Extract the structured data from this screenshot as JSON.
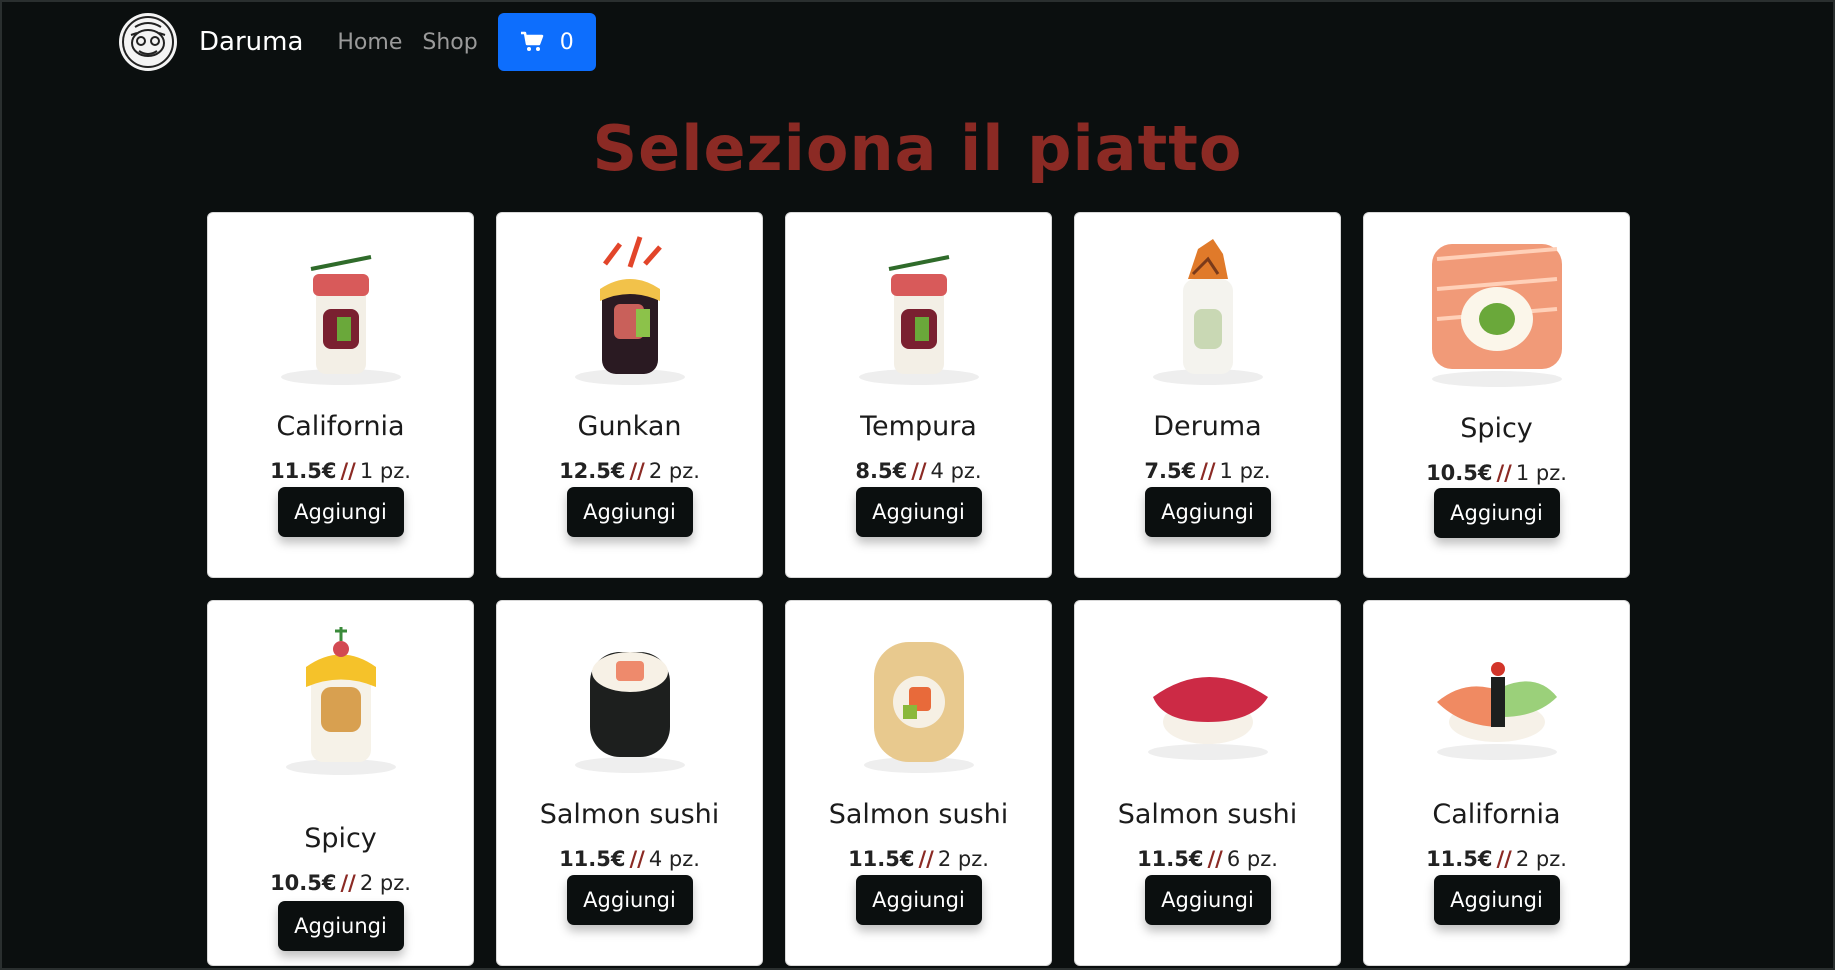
{
  "navbar": {
    "brand": "Daruma",
    "links": [
      "Home",
      "Shop"
    ],
    "cart_count": "0"
  },
  "page_title": "Seleziona il piatto",
  "products": [
    {
      "name": "California",
      "price": "11.5€",
      "sep": "//",
      "qty": "1 pz.",
      "button": "Aggiungi",
      "image": "sushi-roll-tuna-topped"
    },
    {
      "name": "Gunkan",
      "price": "12.5€",
      "sep": "//",
      "qty": "2 pz.",
      "button": "Aggiungi",
      "image": "black-rice-roll"
    },
    {
      "name": "Tempura",
      "price": "8.5€",
      "sep": "//",
      "qty": "4 pz.",
      "button": "Aggiungi",
      "image": "sushi-roll-tuna-topped"
    },
    {
      "name": "Deruma",
      "price": "7.5€",
      "sep": "//",
      "qty": "1 pz.",
      "button": "Aggiungi",
      "image": "cucumber-roll"
    },
    {
      "name": "Spicy",
      "price": "10.5€",
      "sep": "//",
      "qty": "1 pz.",
      "button": "Aggiungi",
      "image": "salmon-roll"
    },
    {
      "name": "Spicy",
      "price": "10.5€",
      "sep": "//",
      "qty": "2 pz.",
      "button": "Aggiungi",
      "image": "tempura-roll-mango"
    },
    {
      "name": "Salmon sushi",
      "price": "11.5€",
      "sep": "//",
      "qty": "4 pz.",
      "button": "Aggiungi",
      "image": "salmon-maki"
    },
    {
      "name": "Salmon sushi",
      "price": "11.5€",
      "sep": "//",
      "qty": "2 pz.",
      "button": "Aggiungi",
      "image": "crispy-roll"
    },
    {
      "name": "Salmon sushi",
      "price": "11.5€",
      "sep": "//",
      "qty": "6 pz.",
      "button": "Aggiungi",
      "image": "tuna-nigiri"
    },
    {
      "name": "California",
      "price": "11.5€",
      "sep": "//",
      "qty": "2 pz.",
      "button": "Aggiungi",
      "image": "salmon-nigiri-avocado"
    }
  ],
  "colors": {
    "background": "#0b0f0f",
    "title": "#8b2a24",
    "cart_button": "#0d6efd",
    "add_button": "#0b0f0f"
  }
}
